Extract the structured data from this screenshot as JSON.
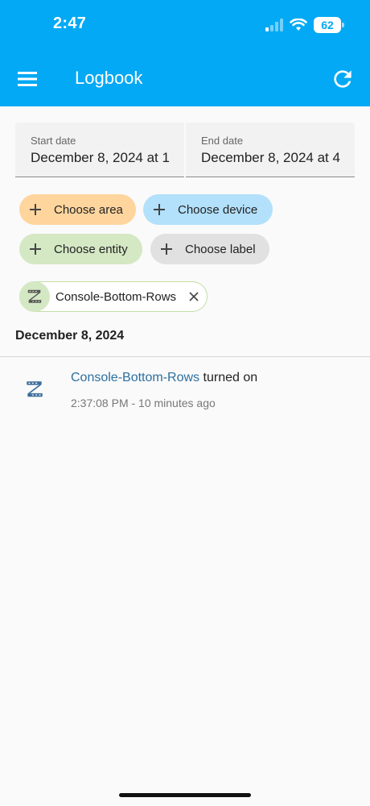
{
  "status_bar": {
    "time": "2:47",
    "battery": "62"
  },
  "header": {
    "title": "Logbook",
    "menu_icon": "hamburger-menu-icon",
    "refresh_icon": "refresh-icon"
  },
  "date_range": {
    "start_label": "Start date",
    "start_value": "December 8, 2024 at 1",
    "end_label": "End date",
    "end_value": "December 8, 2024 at 4"
  },
  "target_pickers": [
    {
      "label": "Choose area",
      "color": "#ffd59e"
    },
    {
      "label": "Choose device",
      "color": "#b3e0fa"
    },
    {
      "label": "Choose entity",
      "color": "#d4e8c4"
    },
    {
      "label": "Choose label",
      "color": "#e1e1e1"
    }
  ],
  "selected_entity": {
    "name": "Console-Bottom-Rows",
    "icon": "led-strip-icon"
  },
  "log": {
    "date": "December 8, 2024",
    "entries": [
      {
        "entity": "Console-Bottom-Rows",
        "action": "turned on",
        "time": "2:37:08 PM - 10 minutes ago"
      }
    ]
  },
  "colors": {
    "primary": "#03a9f4",
    "link": "#2c6fa0"
  }
}
